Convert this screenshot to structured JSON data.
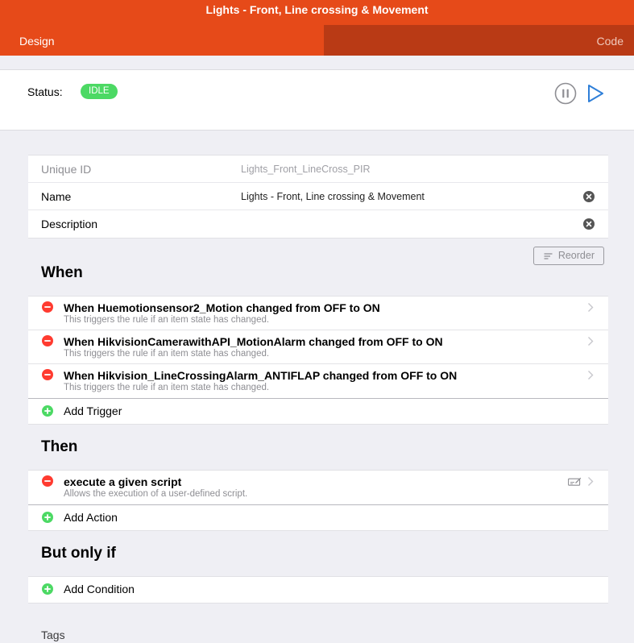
{
  "navbar": {
    "title": "Lights - Front, Line crossing & Movement"
  },
  "tabs": [
    {
      "label": "Design"
    },
    {
      "label": "Code"
    }
  ],
  "status": {
    "label": "Status:",
    "value": "IDLE",
    "badge_color": "#4cd964"
  },
  "details": {
    "unique_id": {
      "label": "Unique ID",
      "value": "Lights_Front_LineCross_PIR"
    },
    "name": {
      "label": "Name",
      "value": "Lights - Front, Line crossing & Movement"
    },
    "description": {
      "label": "Description",
      "value": ""
    }
  },
  "reorder_label": "Reorder",
  "when": {
    "title": "When",
    "triggers": [
      {
        "title": "When Huemotionsensor2_Motion changed from OFF to ON",
        "subtitle": "This triggers the rule if an item state has changed."
      },
      {
        "title": "When HikvisionCamerawithAPI_MotionAlarm changed from OFF to ON",
        "subtitle": "This triggers the rule if an item state has changed."
      },
      {
        "title": "When Hikvision_LineCrossingAlarm_ANTIFLAP changed from OFF to ON",
        "subtitle": "This triggers the rule if an item state has changed."
      }
    ],
    "add_label": "Add Trigger"
  },
  "then": {
    "title": "Then",
    "actions": [
      {
        "title": "execute a given script",
        "subtitle": "Allows the execution of a user-defined script."
      }
    ],
    "add_label": "Add Action"
  },
  "but_only_if": {
    "title": "But only if",
    "add_label": "Add Condition"
  },
  "tags": {
    "title": "Tags"
  },
  "colors": {
    "brand": "#e64a19",
    "tab_inactive": "#b93a15",
    "play": "#2f7fd8",
    "remove": "#ff3b30",
    "add": "#4cd964"
  }
}
